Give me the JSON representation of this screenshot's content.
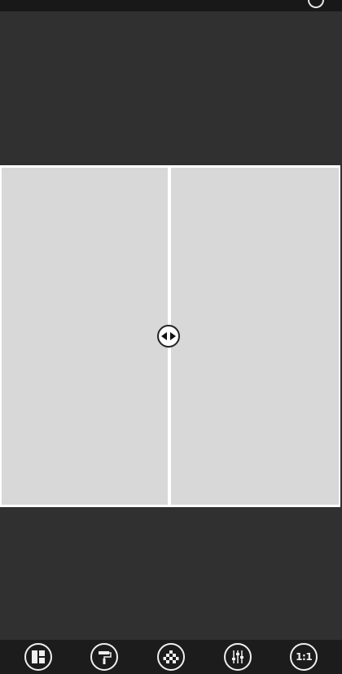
{
  "toolbar": {
    "buttons": [
      {
        "id": "layout",
        "icon": "layout-icon"
      },
      {
        "id": "paint",
        "icon": "paint-roller-icon"
      },
      {
        "id": "pattern",
        "icon": "checkerboard-icon"
      },
      {
        "id": "adjust",
        "icon": "sliders-icon"
      },
      {
        "id": "ratio",
        "icon": "aspect-ratio-icon",
        "label": "1:1"
      }
    ]
  },
  "colors": {
    "background": "#2f2f2f",
    "frame": "#ffffff",
    "cell": "#d8d8d8",
    "toolbar": "#1c1c1c",
    "icon": "#f0f0f0"
  }
}
